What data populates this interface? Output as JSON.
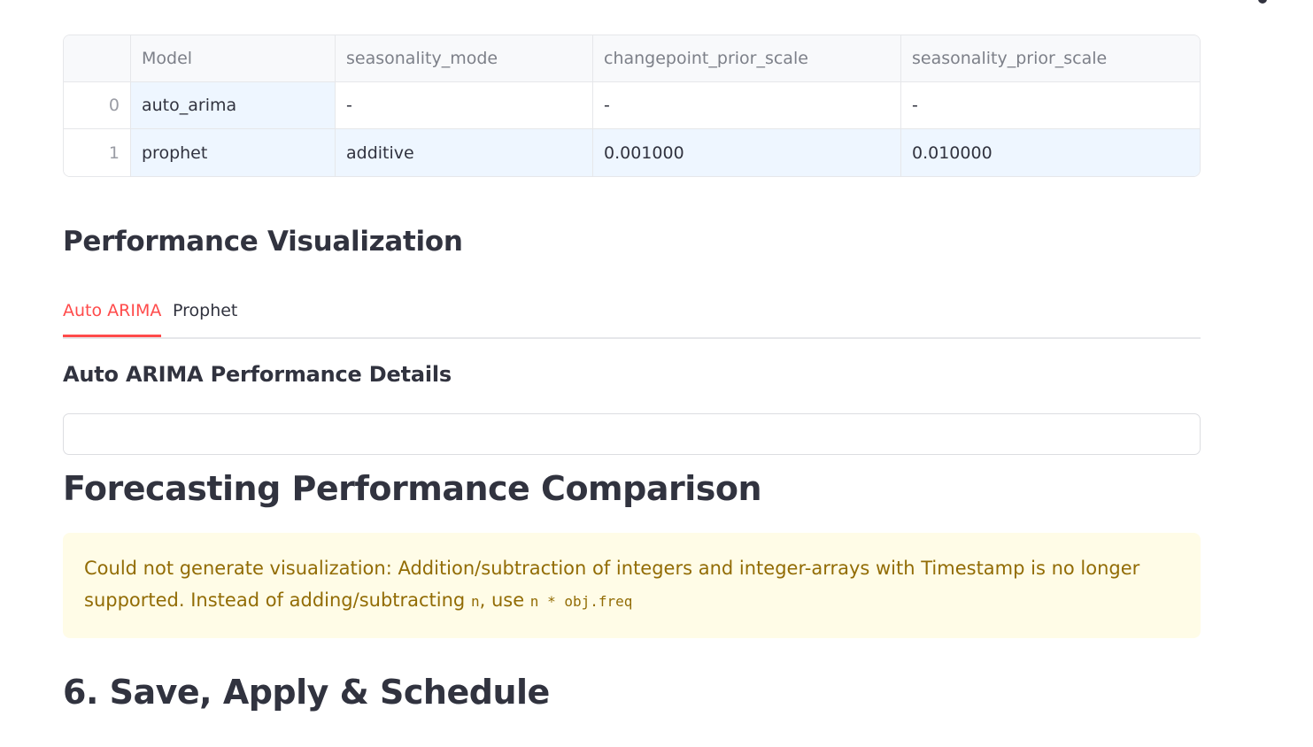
{
  "table": {
    "columns": [
      "",
      "Model",
      "seasonality_mode",
      "changepoint_prior_scale",
      "seasonality_prior_scale"
    ],
    "rows": [
      [
        "0",
        "auto_arima",
        "-",
        "-",
        "-"
      ],
      [
        "1",
        "prophet",
        "additive",
        "0.001000",
        "0.010000"
      ]
    ]
  },
  "section_perf_viz": "Performance Visualization",
  "tabs": [
    {
      "label": "Auto ARIMA",
      "active": true
    },
    {
      "label": "Prophet",
      "active": false
    }
  ],
  "details_heading": "Auto ARIMA Performance Details",
  "forecast_heading": "Forecasting Performance Comparison",
  "warning": {
    "text_1": "Could not generate visualization: Addition/subtraction of integers and integer-arrays with Timestamp is no longer supported. Instead of adding/subtracting ",
    "code_1": "n",
    "text_2": ", use ",
    "code_2": "n * obj.freq"
  },
  "save_heading": "6. Save, Apply & Schedule",
  "colors": {
    "accent": "#ff4b4b",
    "warning_bg": "#fffce7",
    "warning_text": "#926c05",
    "highlight_cell": "#eef6ff"
  }
}
